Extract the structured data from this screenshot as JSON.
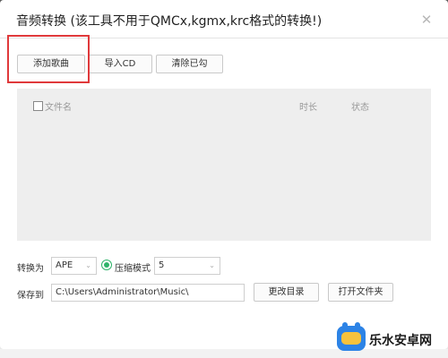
{
  "dialog": {
    "title": "音频转换 (该工具不用于QMCx,kgmx,krc格式的转换!)",
    "close_glyph": "✕"
  },
  "toolbar": {
    "add_song": "添加歌曲",
    "import_cd": "导入CD",
    "clear_checked": "清除已勾"
  },
  "list": {
    "columns": {
      "filename": "文件名",
      "duration": "时长",
      "status": "状态"
    },
    "rows": []
  },
  "convert": {
    "label": "转换为",
    "format": "APE",
    "compress_label": "压缩模式",
    "compress_checked": true,
    "level": "5"
  },
  "save": {
    "label": "保存到",
    "path": "C:\\Users\\Administrator\\Music\\",
    "change_dir": "更改目录",
    "open_folder": "打开文件夹"
  },
  "watermark": {
    "text": "乐水安卓网"
  },
  "colors": {
    "highlight": "#e0393b",
    "radio_accent": "#2fb36a",
    "list_bg": "#eeeeee"
  }
}
